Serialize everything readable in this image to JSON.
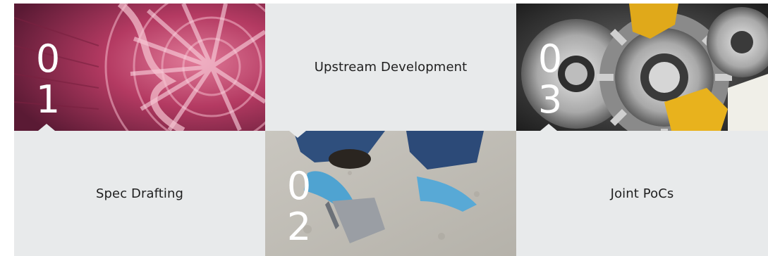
{
  "steps": [
    {
      "number": "01",
      "label": "Spec Drafting",
      "image": "turbine-engine-image"
    },
    {
      "number": "02",
      "label": "Upstream Development",
      "image": "worker-scraping-floor-image"
    },
    {
      "number": "03",
      "label": "Joint PoCs",
      "image": "metal-gears-image"
    }
  ],
  "colors": {
    "panel_bg": "#e8eaeb",
    "text": "#1f1f1f",
    "number": "#ffffff",
    "turbine_tint": "#b8345e"
  }
}
